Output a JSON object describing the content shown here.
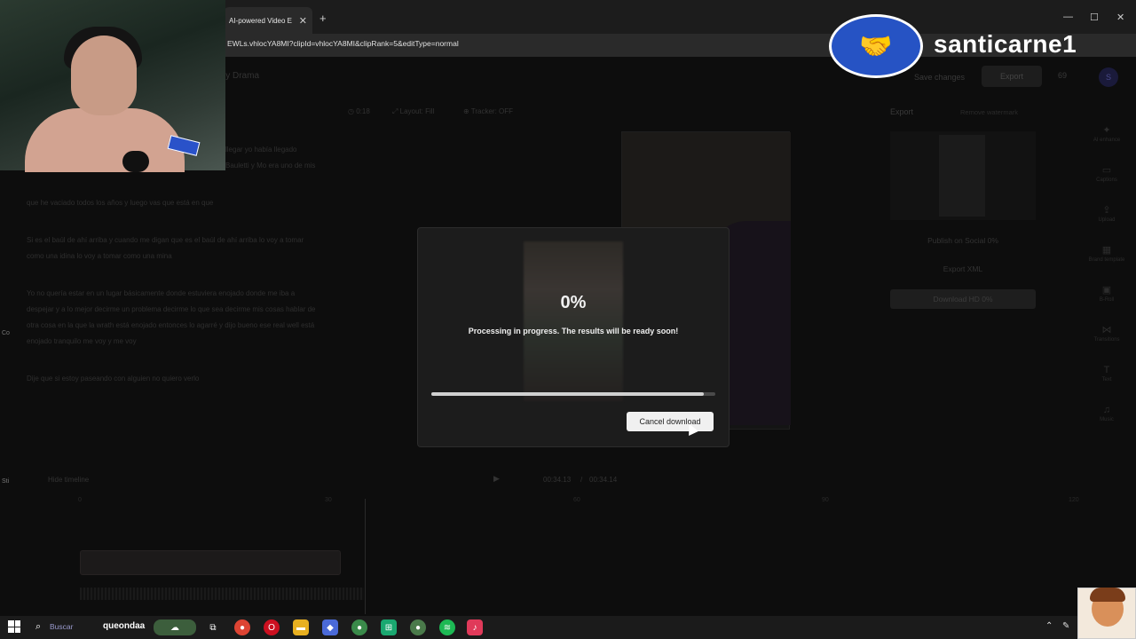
{
  "browser": {
    "tab_title": "AI-powered Video E",
    "tab_close": "✕",
    "new_tab": "+",
    "url": "EWLs.vhlocYA8MI?clipId=vhlocYA8MI&clipRank=5&editType=normal",
    "window_controls": [
      "—",
      "☐",
      "✕"
    ]
  },
  "editor": {
    "project_title": "ly Drama",
    "save_changes": "Save changes",
    "export_label": "Export",
    "credits": "69",
    "avatar_initial": "S",
    "options": {
      "duration": "0:18",
      "layout": "Layout: Fill",
      "tracker": "Tracker: OFF"
    },
    "transcript": [
      "llegar yo había llegado Bauletti y Mo era uno de mis",
      "que he vaciado todos los años y luego vas que está en que",
      "Si es el baúl de ahí arriba y cuando me digan que es el baúl de ahí arriba lo voy a tomar como una idina lo voy a tomar como una mina",
      "Yo no quería estar en un lugar básicamente donde estuviera enojado donde me iba a despejar y a lo mejor decirme un problema decirme lo que sea decirme mis cosas hablar de otra cosa en la que la wrath está enojado entonces lo agarré y dijo bueno ese real well está enojado tranquilo me voy y me voy",
      "Dije que si estoy paseando con alguien no quiero verlo"
    ],
    "export_panel": {
      "title": "Export",
      "remove_watermark": "Remove watermark",
      "publish_social": "Publish on Social 0%",
      "export_xml": "Export XML",
      "download_hd": "Download HD 0%"
    },
    "side_tools": [
      {
        "icon": "✦",
        "label": "AI enhance"
      },
      {
        "icon": "▭",
        "label": "Captions"
      },
      {
        "icon": "⇪",
        "label": "Upload"
      },
      {
        "icon": "▦",
        "label": "Brand template"
      },
      {
        "icon": "▣",
        "label": "B-Roll"
      },
      {
        "icon": "⋈",
        "label": "Transitions"
      },
      {
        "icon": "T",
        "label": "Text"
      },
      {
        "icon": "♫",
        "label": "Music"
      }
    ],
    "timeline": {
      "hide_timeline": "Hide timeline",
      "current_time": "00:34.13",
      "separator": "/",
      "total_time": "00:34.14",
      "ruler": [
        "0",
        "30",
        "60",
        "90",
        "120"
      ]
    }
  },
  "modal": {
    "percent": "0%",
    "progress": 0.96,
    "message": "Processing in progress. The results will be ready soon!",
    "cancel_label": "Cancel download"
  },
  "overlay": {
    "brand_name": "santicarne1",
    "left_edge_labels": [
      "Co",
      "Sti"
    ]
  },
  "taskbar": {
    "search_text": "Buscar",
    "username": "queondaa",
    "sys_icons": [
      "⌃",
      "✎"
    ]
  }
}
